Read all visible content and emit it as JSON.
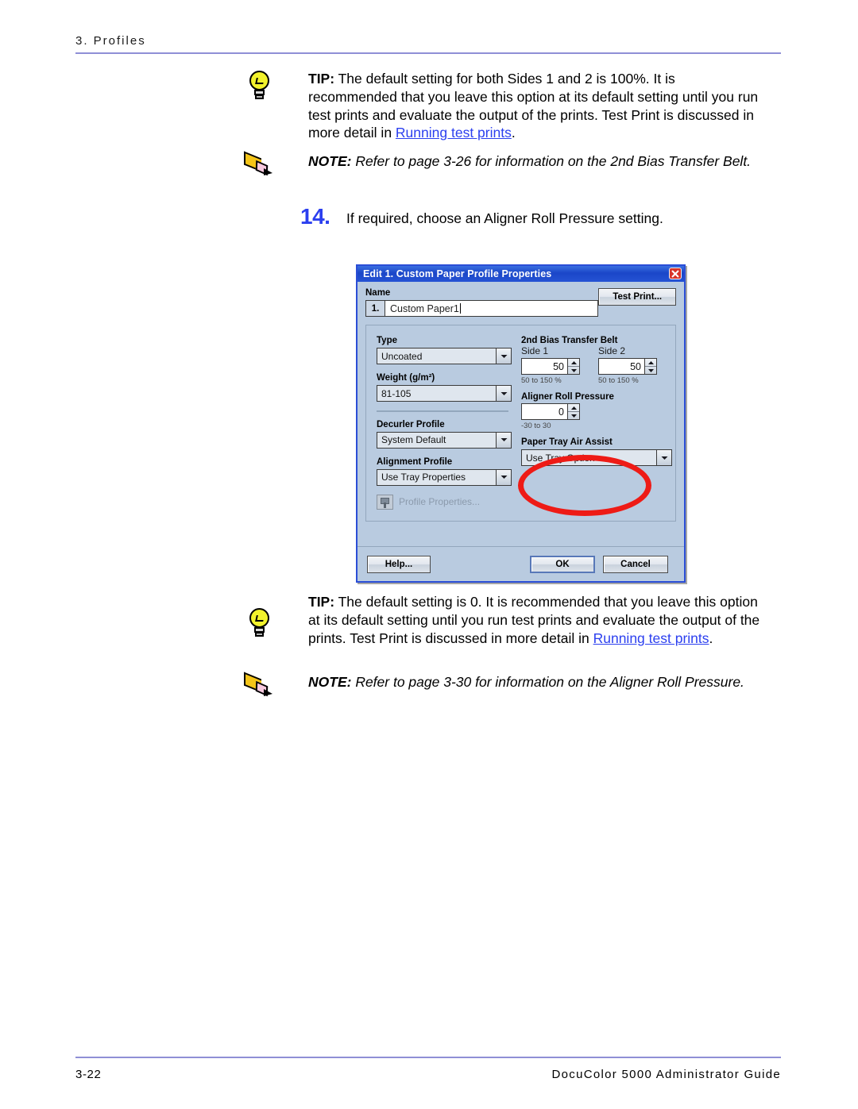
{
  "page": {
    "chapter_header": "3. Profiles",
    "footer_page_number": "3-22",
    "footer_guide": "DocuColor 5000 Administrator Guide"
  },
  "tip_top": {
    "icon": "lightbulb-icon",
    "lead": "TIP:",
    "text_before_link": "  The default setting for both Sides 1 and 2 is 100%.  It is recommended that you leave this option at its default setting until you run test prints and evaluate the output of the prints.  Test Print is discussed in more detail in ",
    "link": "Running test prints",
    "text_after_link": "."
  },
  "note_top": {
    "icon": "pencil-icon",
    "lead": "NOTE:",
    "text": " Refer to page 3-26 for information on the 2nd Bias Transfer Belt."
  },
  "step": {
    "number": "14.",
    "text": "If required, choose an Aligner Roll Pressure setting."
  },
  "dialog": {
    "title": "Edit 1. Custom Paper Profile Properties",
    "close_icon": "close-icon",
    "name_label": "Name",
    "name_index": "1.",
    "name_value": "Custom Paper1",
    "test_print_label": "Test Print...",
    "left_column": {
      "type_label": "Type",
      "type_value": "Uncoated",
      "weight_label": "Weight (g/m²)",
      "weight_value": "81-105",
      "decurler_label": "Decurler Profile",
      "decurler_value": "System Default",
      "alignment_label": "Alignment Profile",
      "alignment_value": "Use Tray Properties",
      "profile_properties_label": "Profile Properties..."
    },
    "right_column": {
      "belt_label": "2nd Bias Transfer Belt",
      "side1_label": "Side 1",
      "side1_value": "50",
      "side1_range": "50 to 150 %",
      "side2_label": "Side 2",
      "side2_value": "50",
      "side2_range": "50 to 150 %",
      "aligner_label": "Aligner Roll Pressure",
      "aligner_value": "0",
      "aligner_range": "-30 to 30",
      "air_assist_label": "Paper Tray Air Assist",
      "air_assist_value": "Use Tray Option"
    },
    "buttons": {
      "help": "Help...",
      "ok": "OK",
      "cancel": "Cancel"
    },
    "annotation": {
      "shape": "red-ellipse-highlight",
      "targets": "Aligner Roll Pressure",
      "color": "#ee1b16"
    }
  },
  "tip_bottom": {
    "icon": "lightbulb-icon",
    "lead": "TIP:",
    "text_before_link": "  The default setting is 0.  It is recommended that you leave this option at its default setting until you run test prints and evaluate the output of the prints.  Test Print is discussed in more detail in ",
    "link": "Running test prints",
    "text_after_link": "."
  },
  "note_bottom": {
    "icon": "pencil-icon",
    "lead": "NOTE:",
    "text": " Refer to page 3-30 for information on the Aligner Roll Pressure."
  },
  "colors": {
    "rule": "#8f8fd6",
    "link": "#2b3fef",
    "step_number": "#2b3fef",
    "dialog_face": "#b9cbe0",
    "titlebar": "#1a46c8",
    "highlight": "#ee1b16"
  }
}
